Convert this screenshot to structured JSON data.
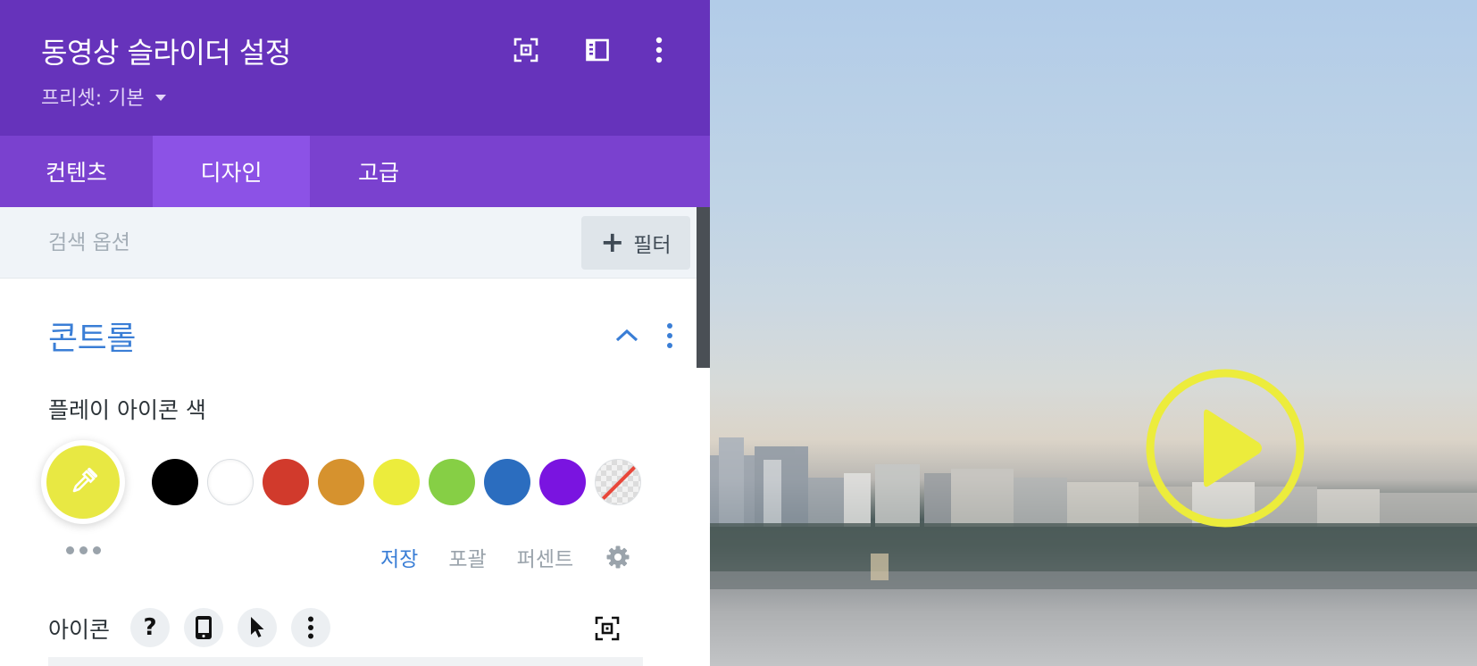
{
  "header": {
    "title": "동영상 슬라이더 설정",
    "preset_label": "프리셋: 기본",
    "icons": [
      "focus-icon",
      "layout-panel-icon",
      "more-vertical-icon"
    ],
    "background": "#6633bb"
  },
  "tabs": [
    {
      "label": "컨텐츠",
      "active": false
    },
    {
      "label": "디자인",
      "active": true
    },
    {
      "label": "고급",
      "active": false
    }
  ],
  "search": {
    "placeholder": "검색 옵션",
    "value": "",
    "filter_label": "필터"
  },
  "section": {
    "title": "콘트롤",
    "expanded": true
  },
  "play_icon_color": {
    "label": "플레이 아이콘 색",
    "selected": "#e8e843",
    "swatches": [
      "#000000",
      "#ffffff",
      "#d13a2c",
      "#d6922e",
      "#ecec3c",
      "#86cf45",
      "#2b6dbf",
      "#7a14e0",
      "transparent"
    ],
    "palette_tabs": [
      {
        "label": "저장",
        "active": true
      },
      {
        "label": "포괄",
        "active": false
      },
      {
        "label": "퍼센트",
        "active": false
      }
    ]
  },
  "icon_field": {
    "label": "아이콘",
    "help": "?"
  },
  "preview": {
    "play_icon_color": "#ecec3c"
  }
}
